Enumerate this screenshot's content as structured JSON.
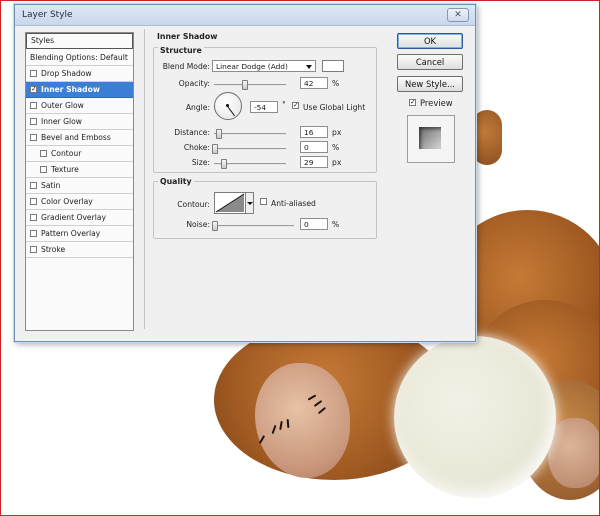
{
  "window": {
    "title": "Layer Style",
    "close_glyph": "✕"
  },
  "styles_panel": {
    "items": [
      {
        "label": "Styles",
        "checkbox": false,
        "checked": false,
        "active": false,
        "header": true,
        "sub": false
      },
      {
        "label": "Blending Options: Default",
        "checkbox": false,
        "checked": false,
        "active": false,
        "header": false,
        "sub": false
      },
      {
        "label": "Drop Shadow",
        "checkbox": true,
        "checked": false,
        "active": false,
        "header": false,
        "sub": false
      },
      {
        "label": "Inner Shadow",
        "checkbox": true,
        "checked": true,
        "active": true,
        "header": false,
        "sub": false
      },
      {
        "label": "Outer Glow",
        "checkbox": true,
        "checked": false,
        "active": false,
        "header": false,
        "sub": false
      },
      {
        "label": "Inner Glow",
        "checkbox": true,
        "checked": false,
        "active": false,
        "header": false,
        "sub": false
      },
      {
        "label": "Bevel and Emboss",
        "checkbox": true,
        "checked": false,
        "active": false,
        "header": false,
        "sub": false
      },
      {
        "label": "Contour",
        "checkbox": true,
        "checked": false,
        "active": false,
        "header": false,
        "sub": true
      },
      {
        "label": "Texture",
        "checkbox": true,
        "checked": false,
        "active": false,
        "header": false,
        "sub": true
      },
      {
        "label": "Satin",
        "checkbox": true,
        "checked": false,
        "active": false,
        "header": false,
        "sub": false
      },
      {
        "label": "Color Overlay",
        "checkbox": true,
        "checked": false,
        "active": false,
        "header": false,
        "sub": false
      },
      {
        "label": "Gradient Overlay",
        "checkbox": true,
        "checked": false,
        "active": false,
        "header": false,
        "sub": false
      },
      {
        "label": "Pattern Overlay",
        "checkbox": true,
        "checked": false,
        "active": false,
        "header": false,
        "sub": false
      },
      {
        "label": "Stroke",
        "checkbox": true,
        "checked": false,
        "active": false,
        "header": false,
        "sub": false
      }
    ]
  },
  "inner_shadow": {
    "section_title": "Inner Shadow",
    "structure": {
      "title": "Structure",
      "blend_mode_label": "Blend Mode:",
      "blend_mode_value": "Linear Dodge (Add)",
      "shadow_color": "#ffffff",
      "opacity_label": "Opacity:",
      "opacity_value": "42",
      "opacity_unit": "%",
      "opacity_level": 0.42,
      "angle_label": "Angle:",
      "angle_value": "-54",
      "angle_unit": "°",
      "angle_degrees": -54,
      "use_global_light_label": "Use Global Light",
      "use_global_light_checked": true,
      "distance_label": "Distance:",
      "distance_value": "16",
      "distance_unit": "px",
      "distance_level": 0.06,
      "choke_label": "Choke:",
      "choke_value": "0",
      "choke_unit": "%",
      "choke_level": 0,
      "size_label": "Size:",
      "size_value": "29",
      "size_unit": "px",
      "size_level": 0.12
    },
    "quality": {
      "title": "Quality",
      "contour_label": "Contour:",
      "anti_aliased_label": "Anti-aliased",
      "anti_aliased_checked": false,
      "noise_label": "Noise:",
      "noise_value": "0",
      "noise_unit": "%",
      "noise_level": 0
    }
  },
  "actions": {
    "ok_label": "OK",
    "cancel_label": "Cancel",
    "new_style_label": "New Style...",
    "preview_label": "Preview",
    "preview_checked": true
  },
  "colors": {
    "accent": "#3a7fd5",
    "border_red": "#d42020"
  }
}
